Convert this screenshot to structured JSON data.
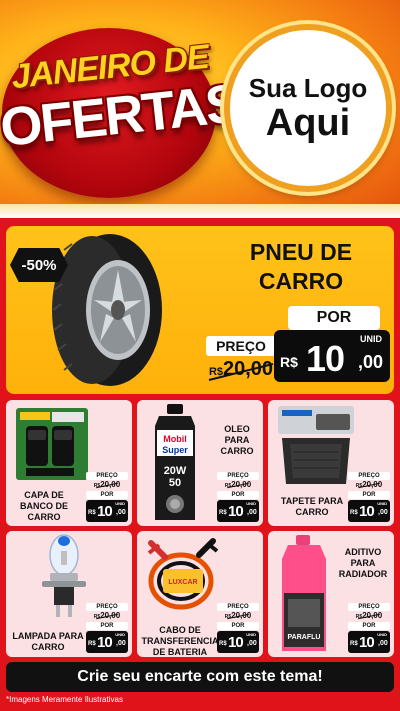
{
  "header": {
    "title_line1": "JANEIRO DE",
    "title_line2": "OFERTAS",
    "logo_line1": "Sua Logo",
    "logo_line2": "Aqui"
  },
  "hero": {
    "discount": "-50%",
    "title_line1": "PNEU DE",
    "title_line2": "CARRO",
    "por_label": "POR",
    "preco_label": "PREÇO",
    "old_currency": "R$",
    "old_value": "20,00",
    "unit_label": "UNID",
    "new_currency": "R$",
    "new_integer": "10",
    "new_cents": ",00"
  },
  "products": [
    {
      "name": "CAPA DE BANCO DE CARRO",
      "preco_label": "PREÇO",
      "old_currency": "R$",
      "old_value": "20,00",
      "por_label": "POR",
      "unit_label": "UNID",
      "new_currency": "R$",
      "new_integer": "10",
      "new_cents": ",00"
    },
    {
      "name": "OLEO PARA CARRO",
      "preco_label": "PREÇO",
      "old_currency": "R$",
      "old_value": "20,00",
      "por_label": "POR",
      "unit_label": "UNID",
      "new_currency": "R$",
      "new_integer": "10",
      "new_cents": ",00"
    },
    {
      "name": "TAPETE PARA CARRO",
      "preco_label": "PREÇO",
      "old_currency": "R$",
      "old_value": "20,00",
      "por_label": "POR",
      "unit_label": "UNID",
      "new_currency": "R$",
      "new_integer": "10",
      "new_cents": ",00"
    },
    {
      "name": "LAMPADA PARA CARRO",
      "preco_label": "PREÇO",
      "old_currency": "R$",
      "old_value": "20,00",
      "por_label": "POR",
      "unit_label": "UNID",
      "new_currency": "R$",
      "new_integer": "10",
      "new_cents": ",00"
    },
    {
      "name": "CABO DE TRANSFERENCIA DE BATERIA",
      "preco_label": "PREÇO",
      "old_currency": "R$",
      "old_value": "20,00",
      "por_label": "POR",
      "unit_label": "UNID",
      "new_currency": "R$",
      "new_integer": "10",
      "new_cents": ",00"
    },
    {
      "name": "ADITIVO PARA RADIADOR",
      "preco_label": "PREÇO",
      "old_currency": "R$",
      "old_value": "20,00",
      "por_label": "POR",
      "unit_label": "UNID",
      "new_currency": "R$",
      "new_integer": "10",
      "new_cents": ",00"
    }
  ],
  "product_art_text": {
    "oil_brand_1": "Mobil",
    "oil_brand_2": "Super",
    "oil_grade_1": "20W",
    "oil_grade_2": "50",
    "cable_brand": "LUXCAR",
    "additive_brand": "PARAFLU"
  },
  "cta": "Crie seu encarte com este tema!",
  "disclaimer": "*Imagens Meramente Ilustrativas",
  "colors": {
    "primary_red": "#e0121a",
    "hero_yellow": "#ffb10a",
    "card_pink": "#fbe0e4",
    "price_black": "#0c0c0c"
  }
}
